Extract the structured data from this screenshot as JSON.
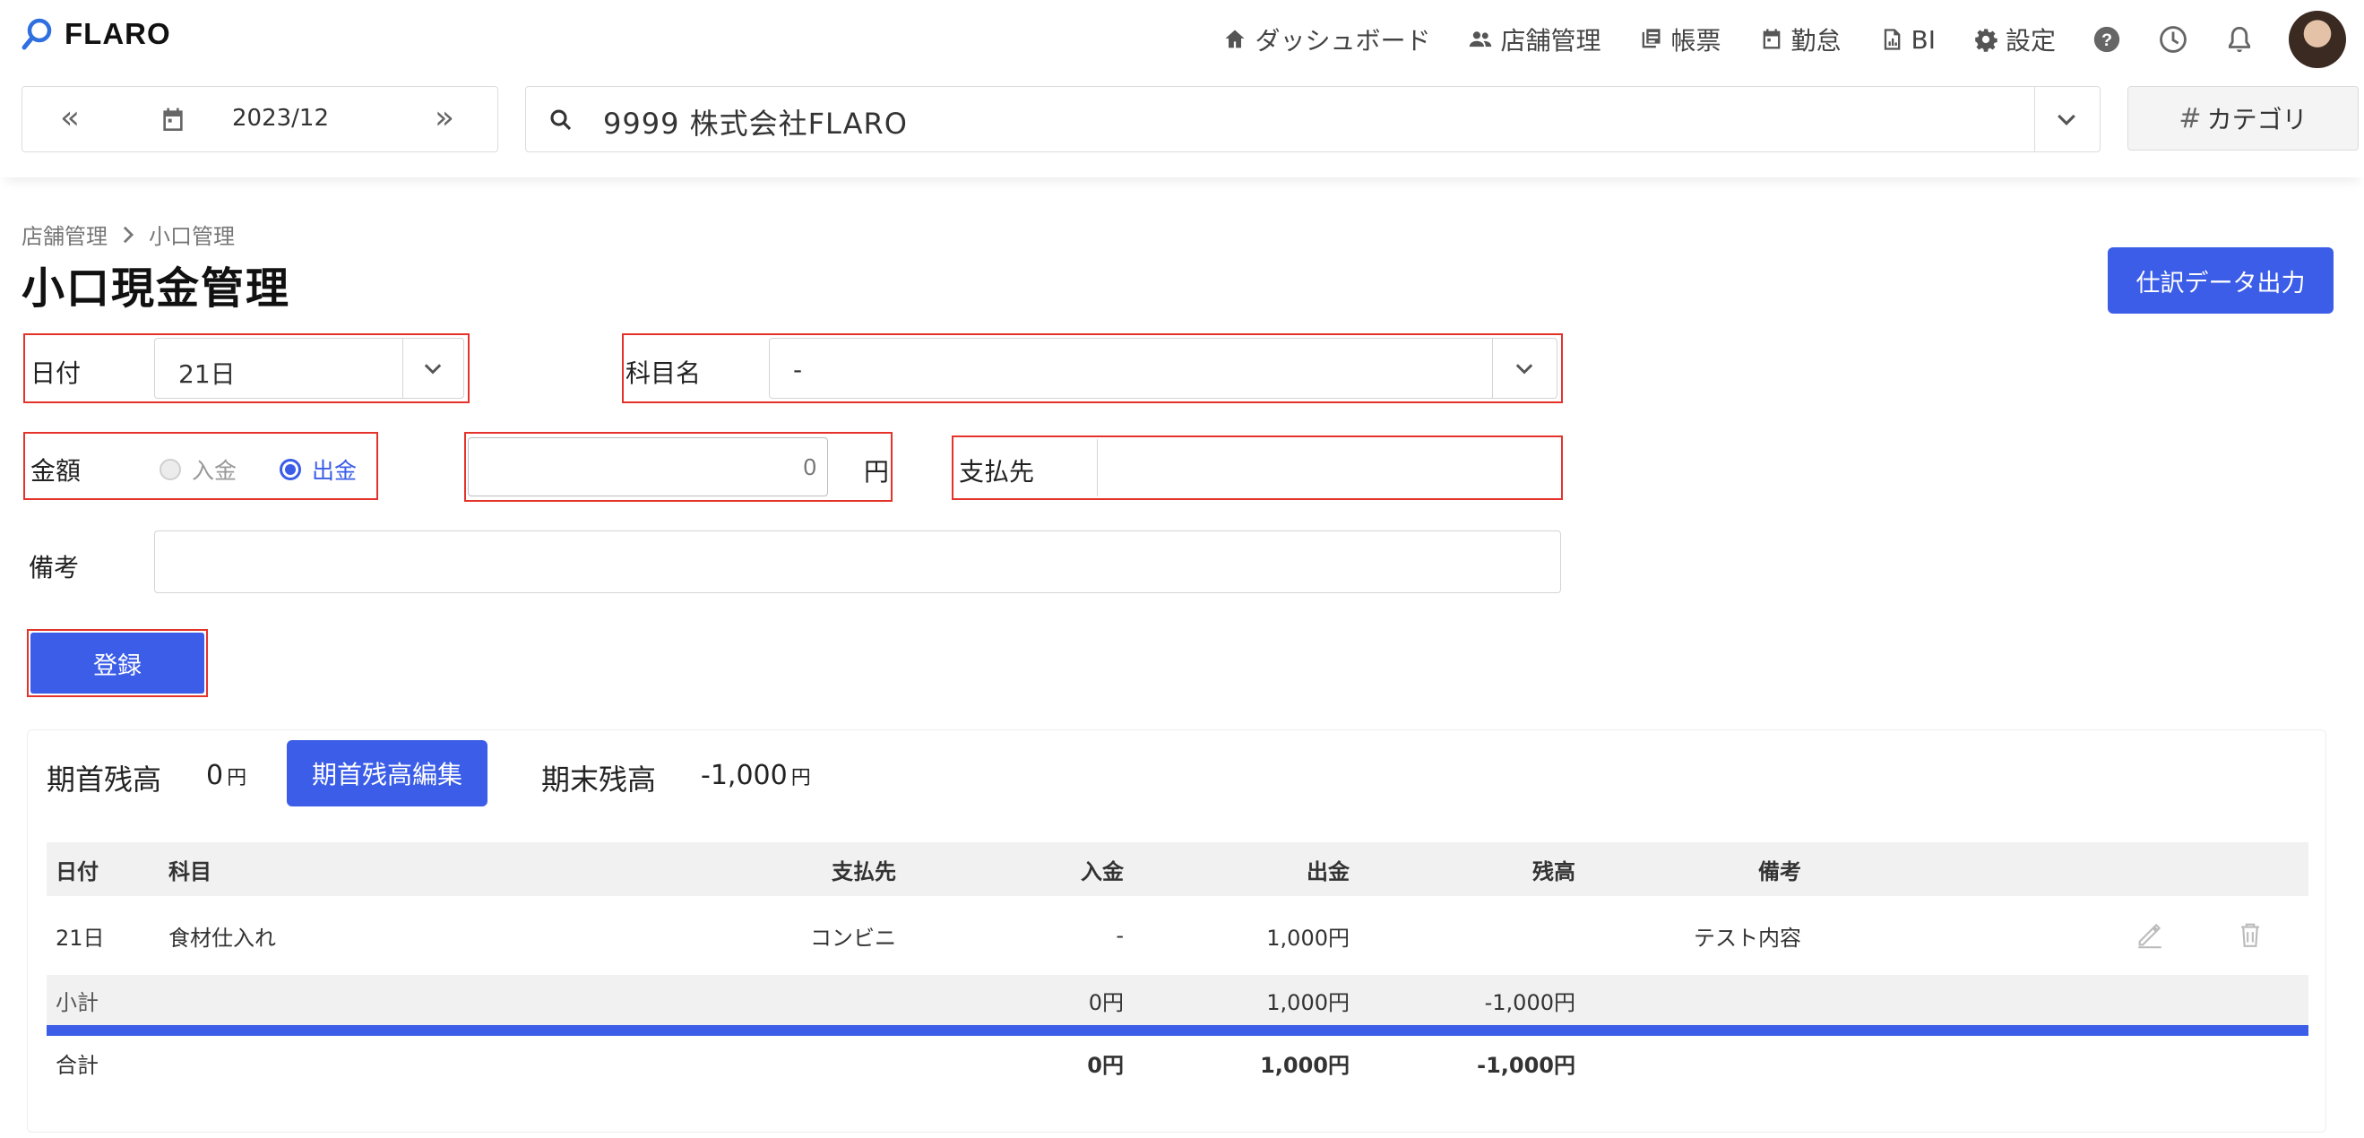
{
  "app": {
    "logo_text": "FLARO"
  },
  "nav": {
    "items": [
      {
        "label": "ダッシュボード",
        "icon": "home-icon"
      },
      {
        "label": "店舗管理",
        "icon": "people-icon"
      },
      {
        "label": "帳票",
        "icon": "document-icon"
      },
      {
        "label": "勤怠",
        "icon": "calendar-icon"
      },
      {
        "label": "BI",
        "icon": "chart-icon"
      },
      {
        "label": "設定",
        "icon": "gear-icon"
      }
    ],
    "right_icons": [
      "help-icon",
      "clock-icon",
      "bell-icon"
    ]
  },
  "toolbar": {
    "date": "2023/12",
    "company": "9999 株式会社FLARO",
    "category_label": "カテゴリ"
  },
  "breadcrumb": {
    "parent": "店舗管理",
    "current": "小口管理"
  },
  "page": {
    "title": "小口現金管理",
    "export_label": "仕訳データ出力"
  },
  "form": {
    "date_label": "日付",
    "date_value": "21日",
    "subject_label": "科目名",
    "subject_value": "-",
    "amount_label": "金額",
    "radio_in": "入金",
    "radio_out": "出金",
    "amount_placeholder": "0",
    "yen": "円",
    "payee_label": "支払先",
    "payee_value": "",
    "memo_label": "備考",
    "memo_value": "",
    "submit_label": "登録"
  },
  "balance": {
    "opening_label": "期首残高",
    "opening_value": "0",
    "opening_unit": "円",
    "edit_label": "期首残高編集",
    "closing_label": "期末残高",
    "closing_value": "-1,000",
    "closing_unit": "円"
  },
  "table": {
    "headers": [
      "日付",
      "科目",
      "支払先",
      "入金",
      "出金",
      "残高",
      "備考"
    ],
    "rows": [
      {
        "date": "21日",
        "subject": "食材仕入れ",
        "payee": "コンビニ",
        "in": "-",
        "out": "1,000円",
        "balance": "",
        "memo": "テスト内容"
      }
    ],
    "subtotal": {
      "label": "小計",
      "in": "0円",
      "out": "1,000円",
      "balance": "-1,000円"
    },
    "total": {
      "label": "合計",
      "in": "0円",
      "out": "1,000円",
      "balance": "-1,000円"
    }
  },
  "colors": {
    "accent": "#3b5de7",
    "highlight": "#e4332a"
  }
}
